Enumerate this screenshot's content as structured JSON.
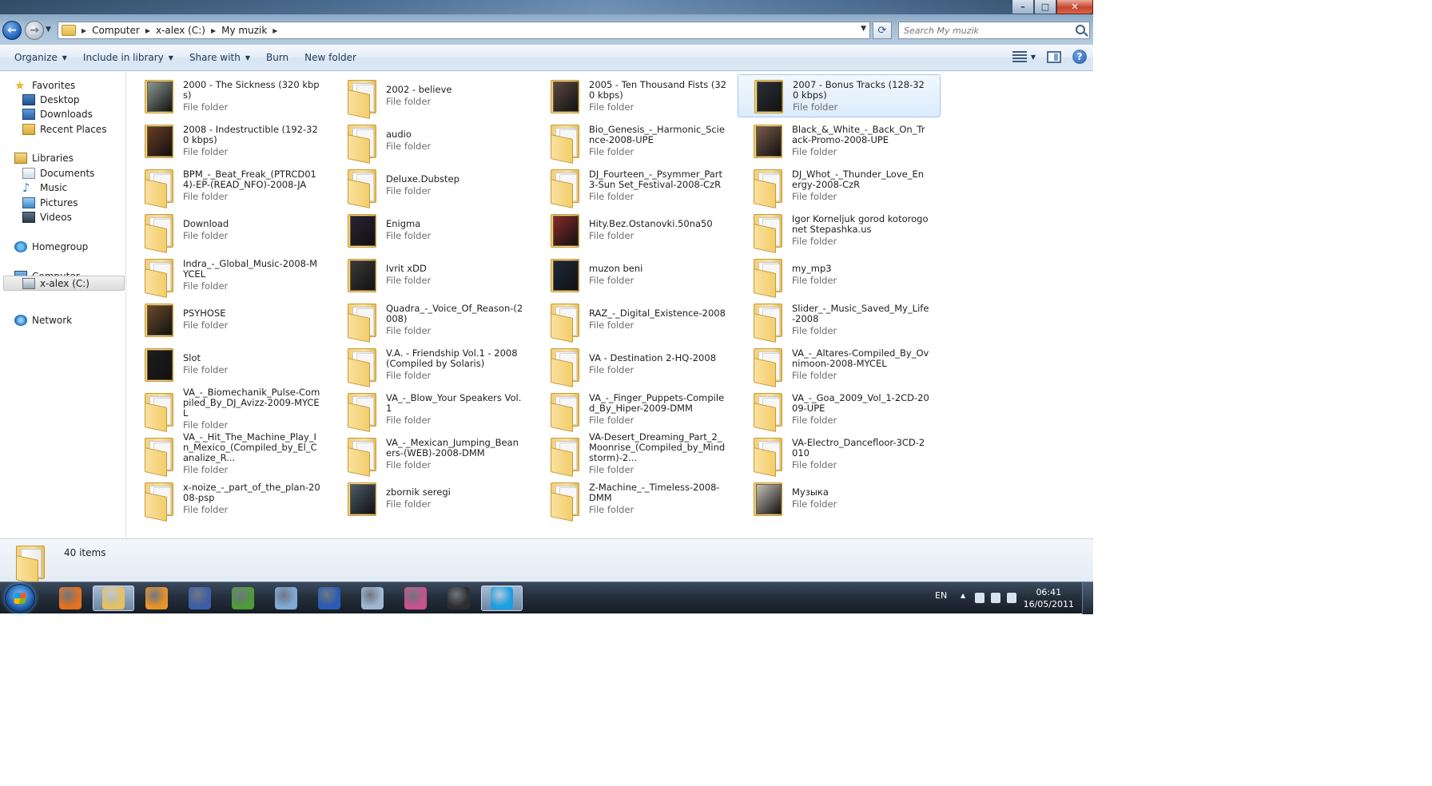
{
  "address": {
    "crumbs": [
      "Computer",
      "x-alex (C:)",
      "My muzik"
    ],
    "search_placeholder": "Search My muzik"
  },
  "caption": {
    "minimize": "–",
    "maximize": "□",
    "close": "✕"
  },
  "toolbar": {
    "organize": "Organize",
    "include_in_library": "Include in library",
    "share_with": "Share with",
    "burn": "Burn",
    "new_folder": "New folder"
  },
  "nav": {
    "favorites": "Favorites",
    "desktop": "Desktop",
    "downloads": "Downloads",
    "recent_places": "Recent Places",
    "libraries": "Libraries",
    "documents": "Documents",
    "music": "Music",
    "pictures": "Pictures",
    "videos": "Videos",
    "homegroup": "Homegroup",
    "computer": "Computer",
    "drive_c": "x-alex (C:)",
    "network": "Network"
  },
  "folder_type": "File folder",
  "folders": [
    {
      "name": "2000 - The Sickness (320 kbps)",
      "art": "#8a9a8f"
    },
    {
      "name": "2002 - believe"
    },
    {
      "name": "2005 - Ten Thousand Fists (320 kbps)",
      "art": "#5b4a3f"
    },
    {
      "name": "2007 - Bonus Tracks (128-320 kbps)",
      "art": "#2c3137",
      "selected": true
    },
    {
      "name": "2008 - Indestructible (192-320 kbps)",
      "art": "#6b3b22"
    },
    {
      "name": "audio"
    },
    {
      "name": "Bio_Genesis_-_Harmonic_Science-2008-UPE"
    },
    {
      "name": "Black_&_White_-_Back_On_Track-Promo-2008-UPE",
      "art": "#7a5a4a"
    },
    {
      "name": "BPM_-_Beat_Freak_(PTRCD014)-EP-(READ_NFO)-2008-JA"
    },
    {
      "name": "Deluxe.Dubstep"
    },
    {
      "name": "DJ_Fourteen_-_Psymmer_Part3-Sun Set_Festival-2008-CzR"
    },
    {
      "name": "DJ_Whot_-_Thunder_Love_Energy-2008-CzR"
    },
    {
      "name": "Download"
    },
    {
      "name": "Enigma",
      "art": "#2a2233"
    },
    {
      "name": "Hity.Bez.Ostanovki.50na50",
      "art": "#8a2a2a"
    },
    {
      "name": "Igor Korneljuk gorod kotorogo net Stepashka.us"
    },
    {
      "name": "Indra_-_Global_Music-2008-MYCEL"
    },
    {
      "name": "Ivrit xDD",
      "art": "#3a3a3a"
    },
    {
      "name": "muzon beni",
      "art": "#1f2a3a"
    },
    {
      "name": "my_mp3"
    },
    {
      "name": "PSYHOSE",
      "art": "#6b4a2a"
    },
    {
      "name": "Quadra_-_Voice_Of_Reason-(2008)"
    },
    {
      "name": "RAZ_-_Digital_Existence-2008"
    },
    {
      "name": "Slider_-_Music_Saved_My_Life-2008"
    },
    {
      "name": "Slot",
      "art": "#1d1d1d"
    },
    {
      "name": "V.A. - Friendship Vol.1 - 2008 (Compiled by Solaris)"
    },
    {
      "name": "VA - Destination 2-HQ-2008"
    },
    {
      "name": "VA_-_Altares-Compiled_By_Ovnimoon-2008-MYCEL"
    },
    {
      "name": "VA_-_Biomechanik_Pulse-Compiled_By_DJ_Avizz-2009-MYCEL"
    },
    {
      "name": "VA_-_Blow_Your Speakers Vol.1"
    },
    {
      "name": "VA_-_Finger_Puppets-Compiled_By_Hiper-2009-DMM"
    },
    {
      "name": "VA_-_Goa_2009_Vol_1-2CD-2009-UPE"
    },
    {
      "name": "VA_-_Hit_The_Machine_Play_In_Mexico_(Compiled_by_El_Canalize_R..."
    },
    {
      "name": "VA_-_Mexican_Jumping_Beaners-(WEB)-2008-DMM"
    },
    {
      "name": "VA-Desert_Dreaming_Part_2_Moonrise_(Compiled_by_Mindstorm)-2..."
    },
    {
      "name": "VA-Electro_Dancefloor-3CD-2010"
    },
    {
      "name": "x-noize_-_part_of_the_plan-2008-psp"
    },
    {
      "name": "zbornik seregi",
      "art": "#4a5a6a"
    },
    {
      "name": "Z-Machine_-_Timeless-2008-DMM"
    },
    {
      "name": "Музыка",
      "art": "#c8c0b8"
    }
  ],
  "status": {
    "item_count": "40 items"
  },
  "taskbar": {
    "language": "EN",
    "time": "06:41",
    "date": "16/05/2011",
    "apps": [
      {
        "name": "firefox",
        "color": "#e3711f"
      },
      {
        "name": "explorer",
        "color": "#e5c060",
        "active": true
      },
      {
        "name": "media-player",
        "color": "#e8922a"
      },
      {
        "name": "equalizer-app",
        "color": "#3c5ea8"
      },
      {
        "name": "music-app",
        "color": "#4f9a3a"
      },
      {
        "name": "paint",
        "color": "#7fa9d6"
      },
      {
        "name": "word",
        "color": "#2a5cb4"
      },
      {
        "name": "calculator",
        "color": "#9fb8d2"
      },
      {
        "name": "photo-app",
        "color": "#c8528e"
      },
      {
        "name": "game-app",
        "color": "#2e2e2e"
      },
      {
        "name": "skype",
        "color": "#1aa0e4",
        "active": true
      }
    ]
  }
}
